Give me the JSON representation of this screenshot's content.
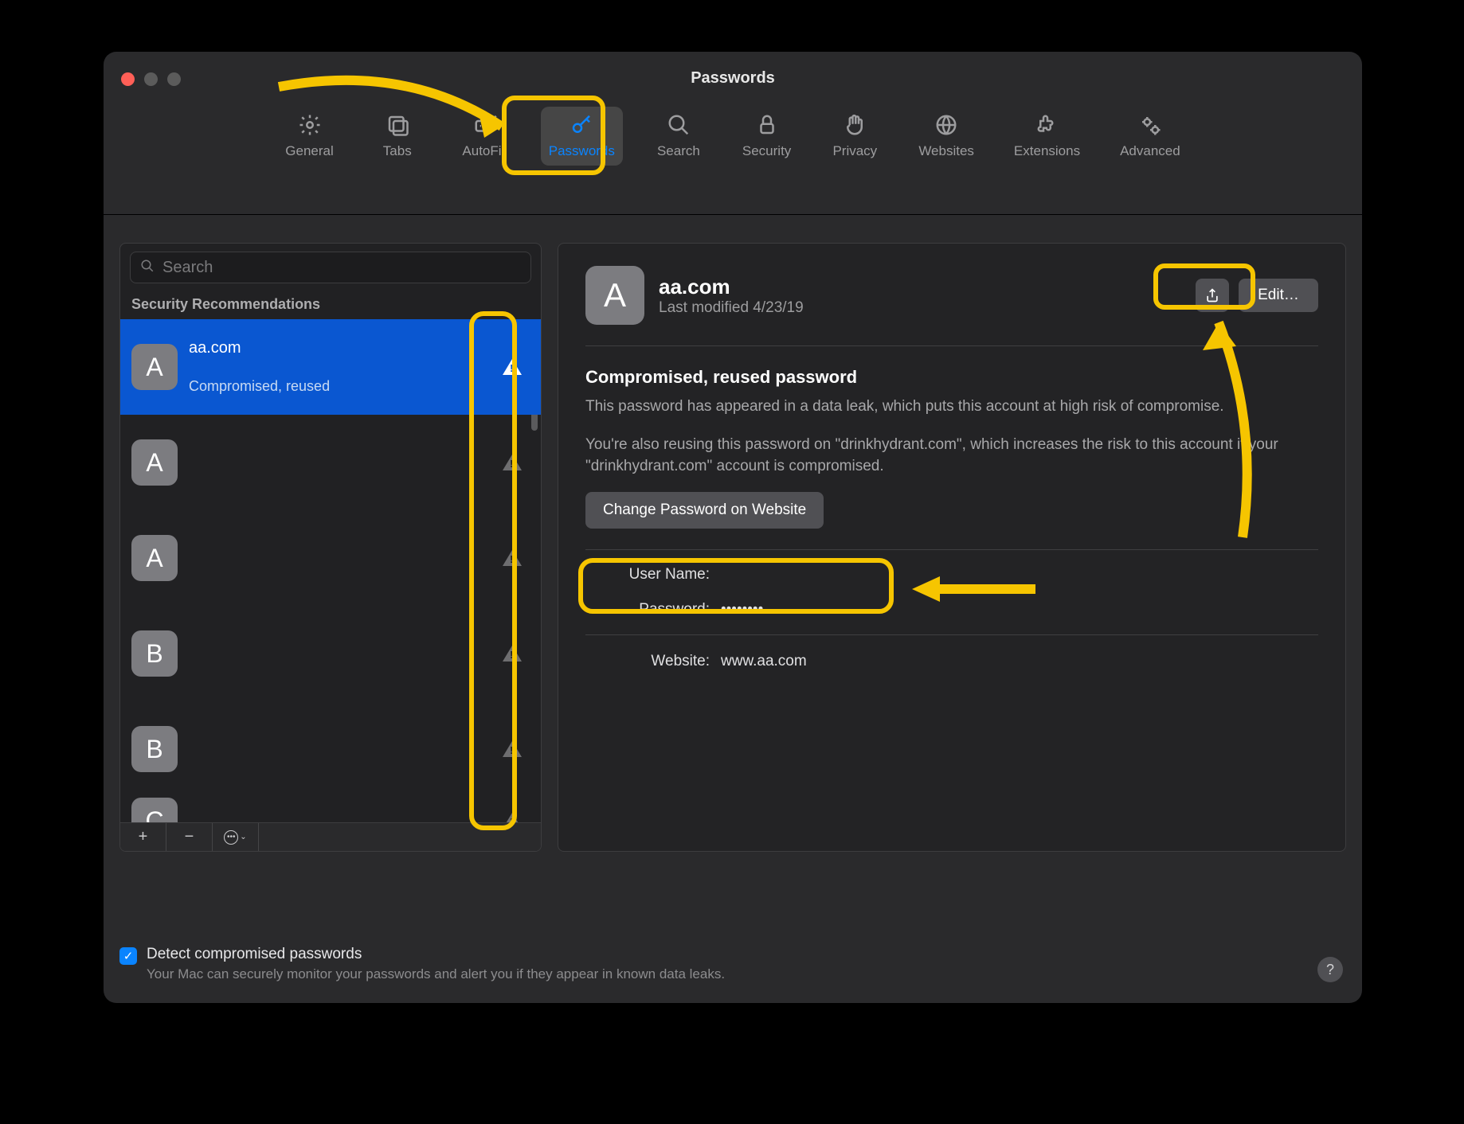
{
  "window": {
    "title": "Passwords"
  },
  "toolbar": {
    "items": [
      {
        "label": "General"
      },
      {
        "label": "Tabs"
      },
      {
        "label": "AutoFill"
      },
      {
        "label": "Passwords"
      },
      {
        "label": "Search"
      },
      {
        "label": "Security"
      },
      {
        "label": "Privacy"
      },
      {
        "label": "Websites"
      },
      {
        "label": "Extensions"
      },
      {
        "label": "Advanced"
      }
    ]
  },
  "sidebar": {
    "search_placeholder": "Search",
    "header": "Security Recommendations",
    "items": [
      {
        "letter": "A",
        "title": "aa.com",
        "sub": "Compromised, reused"
      },
      {
        "letter": "A",
        "title": "",
        "sub": ""
      },
      {
        "letter": "A",
        "title": "",
        "sub": ""
      },
      {
        "letter": "B",
        "title": "",
        "sub": ""
      },
      {
        "letter": "B",
        "title": "",
        "sub": ""
      },
      {
        "letter": "C",
        "title": "",
        "sub": ""
      }
    ],
    "footer": {
      "add": "+",
      "remove": "−",
      "more": "⊙⌄"
    }
  },
  "detail": {
    "title": "aa.com",
    "subtitle": "Last modified 4/23/19",
    "edit_label": "Edit…",
    "section_title": "Compromised, reused password",
    "section_body1": "This password has appeared in a data leak, which puts this account at high risk of compromise.",
    "section_body2": "You're also reusing this password on \"drinkhydrant.com\", which increases the risk to this account if your \"drinkhydrant.com\" account is compromised.",
    "change_label": "Change Password on Website",
    "fields": {
      "username_label": "User Name:",
      "username_value": "",
      "password_label": "Password:",
      "password_value": "••••••••",
      "website_label": "Website:",
      "website_value": "www.aa.com"
    }
  },
  "footer": {
    "checkbox_label": "Detect compromised passwords",
    "checkbox_desc": "Your Mac can securely monitor your passwords and alert you if they appear in known data leaks."
  }
}
